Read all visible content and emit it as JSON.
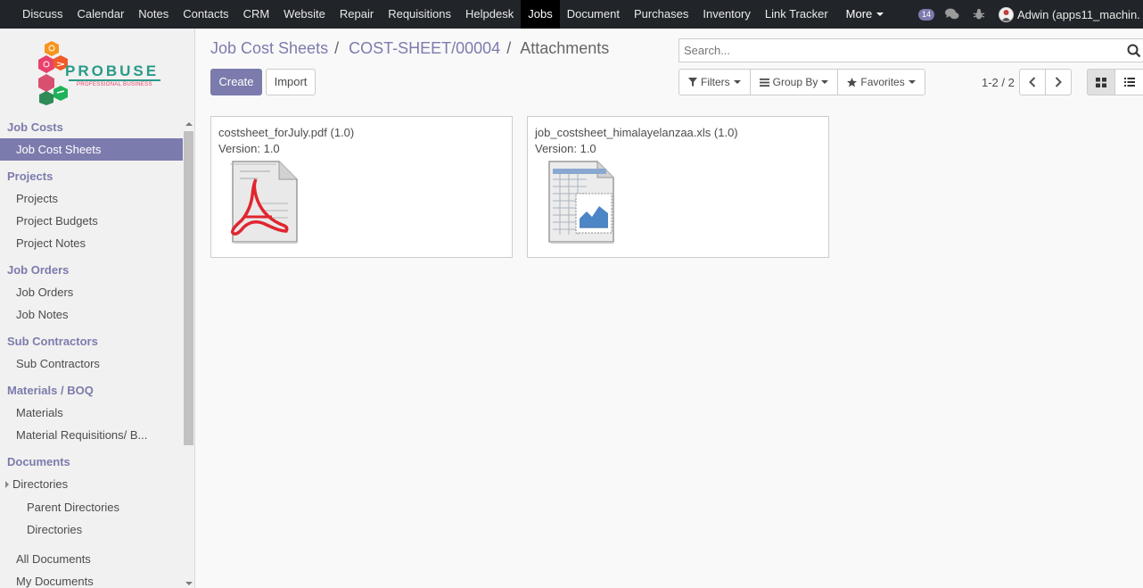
{
  "topnav": {
    "apps": [
      "Discuss",
      "Calendar",
      "Notes",
      "Contacts",
      "CRM",
      "Website",
      "Repair",
      "Requisitions",
      "Helpdesk",
      "Jobs",
      "Document",
      "Purchases",
      "Inventory",
      "Link Tracker"
    ],
    "active_app": "Jobs",
    "more_label": "More",
    "message_count": "14",
    "user_name": "Adwin (apps11_machin."
  },
  "logo": {
    "name": "PROBUSE",
    "tagline": "PROFESSIONAL BUSINESS",
    "colors": [
      "#f15a29",
      "#e8416b",
      "#1fb25a",
      "#2e8b57"
    ]
  },
  "sidebar": {
    "sections": [
      {
        "label": "Job Costs",
        "items": [
          {
            "label": "Job Cost Sheets",
            "active": true
          }
        ]
      },
      {
        "label": "Projects",
        "items": [
          {
            "label": "Projects"
          },
          {
            "label": "Project Budgets"
          },
          {
            "label": "Project Notes"
          }
        ]
      },
      {
        "label": "Job Orders",
        "items": [
          {
            "label": "Job Orders"
          },
          {
            "label": "Job Notes"
          }
        ]
      },
      {
        "label": "Sub Contractors",
        "items": [
          {
            "label": "Sub Contractors"
          }
        ]
      },
      {
        "label": "Materials / BOQ",
        "items": [
          {
            "label": "Materials"
          },
          {
            "label": "Material Requisitions/ B..."
          }
        ]
      },
      {
        "label": "Documents",
        "items": [
          {
            "label": "Directories"
          },
          {
            "label": "Parent Directories"
          },
          {
            "label": "Directories"
          },
          {
            "label": "All Documents"
          },
          {
            "label": "My Documents"
          }
        ]
      }
    ]
  },
  "breadcrumb": {
    "level1": "Job Cost Sheets",
    "level2": "COST-SHEET/00004",
    "current": "Attachments"
  },
  "buttons": {
    "create": "Create",
    "import": "Import"
  },
  "search": {
    "placeholder": "Search..."
  },
  "filters": {
    "filters_label": "Filters",
    "group_by_label": "Group By",
    "favorites_label": "Favorites"
  },
  "pager": {
    "value": "1-2 / 2"
  },
  "attachments": [
    {
      "name": "costsheet_forJuly.pdf (1.0)",
      "version": "Version: 1.0",
      "icon": "pdf-file-icon"
    },
    {
      "name": "job_costsheet_himalayelanzaa.xls (1.0)",
      "version": "Version: 1.0",
      "icon": "spreadsheet-file-icon"
    }
  ],
  "colors": {
    "accent": "#7c7bad",
    "navbar": "#212529"
  }
}
